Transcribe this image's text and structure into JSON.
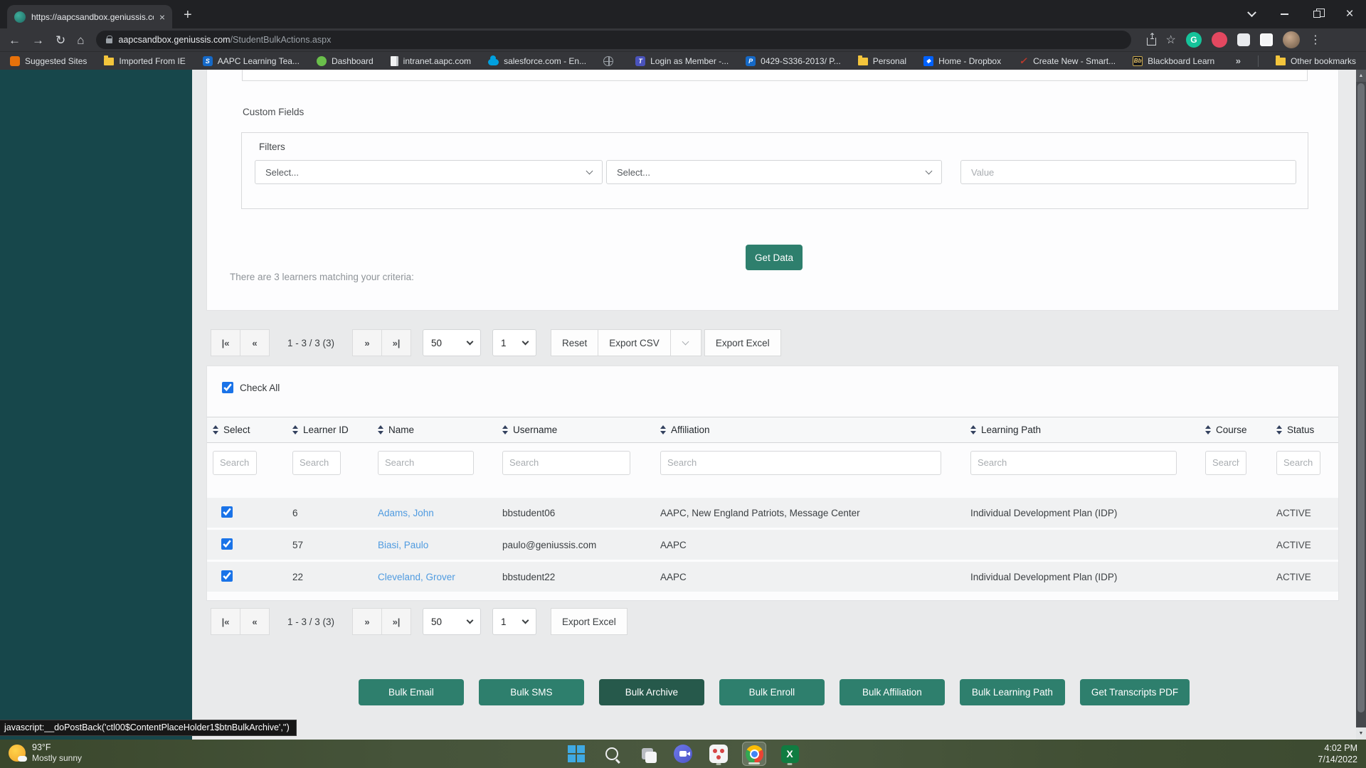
{
  "browser": {
    "tab_title": "https://aapcsandbox.geniussis.co",
    "url_host": "aapcsandbox.geniussis.com",
    "url_path": "/StudentBulkActions.aspx",
    "bookmarks": [
      {
        "label": "Suggested Sites"
      },
      {
        "label": "Imported From IE"
      },
      {
        "label": "AAPC Learning Tea..."
      },
      {
        "label": "Dashboard"
      },
      {
        "label": "intranet.aapc.com"
      },
      {
        "label": "salesforce.com - En..."
      },
      {
        "label": ""
      },
      {
        "label": "Login as Member -..."
      },
      {
        "label": "0429-S336-2013/ P..."
      },
      {
        "label": "Personal"
      },
      {
        "label": "Home - Dropbox"
      },
      {
        "label": "Create New - Smart..."
      },
      {
        "label": "Blackboard Learn"
      }
    ],
    "bookmarks_overflow": "»",
    "other_bookmarks": "Other bookmarks"
  },
  "icons": {
    "back": "←",
    "forward": "→",
    "reload": "↻",
    "home": "⌂",
    "star": "☆",
    "menu": "⋮",
    "close": "×",
    "newtab": "+",
    "grammarly": "G",
    "dropbox_glyph": "◆",
    "check_glyph": "✓",
    "bb_glyph": "Bb",
    "blue_s": "S",
    "blue_p": "P",
    "indigo_t": "T",
    "pager_first": "|«",
    "pager_prev": "«",
    "pager_next": "»",
    "pager_last": "»|",
    "scroll_up": "▲",
    "scroll_down": "▼"
  },
  "page": {
    "custom_fields_label": "Custom Fields",
    "filters": {
      "legend": "Filters",
      "select1_value": "Select...",
      "select2_value": "Select...",
      "value_placeholder": "Value"
    },
    "get_data_label": "Get Data",
    "results_text": "There are 3 learners matching your criteria:",
    "pager": {
      "range": "1 - 3 / 3 (3)",
      "page_size": "50",
      "page_number": "1",
      "reset_label": "Reset",
      "export_csv_label": "Export CSV",
      "export_excel_label": "Export Excel"
    },
    "check_all_label": "Check All",
    "table": {
      "search_placeholder": "Search",
      "columns": [
        "Select",
        "Learner ID",
        "Name",
        "Username",
        "Affiliation",
        "Learning Path",
        "Course",
        "Status"
      ],
      "rows": [
        {
          "id": "6",
          "name": "Adams, John",
          "username": "bbstudent06",
          "affiliation": "AAPC, New England Patriots, Message Center",
          "learning_path": "Individual Development Plan (IDP)",
          "course": "",
          "status": "ACTIVE"
        },
        {
          "id": "57",
          "name": "Biasi, Paulo",
          "username": "paulo@geniussis.com",
          "affiliation": "AAPC",
          "learning_path": "",
          "course": "",
          "status": "ACTIVE"
        },
        {
          "id": "22",
          "name": "Cleveland, Grover",
          "username": "bbstudent22",
          "affiliation": "AAPC",
          "learning_path": "Individual Development Plan (IDP)",
          "course": "",
          "status": "ACTIVE"
        }
      ]
    },
    "bulk_buttons": {
      "email": "Bulk Email",
      "sms": "Bulk SMS",
      "archive": "Bulk Archive",
      "enroll": "Bulk Enroll",
      "affiliation": "Bulk Affiliation",
      "learning_path": "Bulk Learning Path",
      "transcripts": "Get Transcripts PDF"
    },
    "status_link": "javascript:__doPostBack('ctl00$ContentPlaceHolder1$btnBulkArchive','')"
  },
  "colors": {
    "accent_teal": "#2e7f6d",
    "accent_teal_dark": "#26594b",
    "sidebar_teal": "#17474b",
    "link_blue": "#4f9be0",
    "checkbox_blue": "#1a73e8"
  },
  "taskbar": {
    "temperature": "93°F",
    "condition": "Mostly sunny",
    "time": "4:02 PM",
    "date": "7/14/2022"
  }
}
